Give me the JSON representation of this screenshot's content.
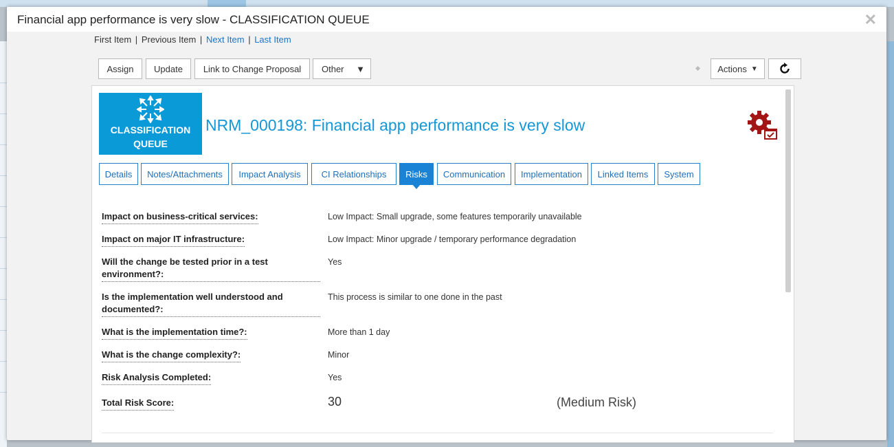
{
  "modal": {
    "title": "Financial app performance is very slow - CLASSIFICATION QUEUE",
    "close_icon": "close-icon"
  },
  "navigation": {
    "first_item": "First Item",
    "previous_item": "Previous Item",
    "next_item": "Next Item",
    "last_item": "Last Item",
    "separator": "|"
  },
  "toolbar": {
    "assign": "Assign",
    "update": "Update",
    "link_to_change_proposal": "Link to Change Proposal",
    "other": "Other",
    "actions": "Actions",
    "refresh_icon": "refresh-icon"
  },
  "record": {
    "queue_label_line1": "CLASSIFICATION",
    "queue_label_line2": "QUEUE",
    "title": "NRM_000198: Financial app performance is very slow",
    "status_icon": "gear-checklist-icon"
  },
  "tabs": [
    {
      "label": "Details"
    },
    {
      "label": "Notes/Attachments"
    },
    {
      "label": "Impact Analysis"
    },
    {
      "label": "CI Relationships"
    },
    {
      "label": "Risks"
    },
    {
      "label": "Communication"
    },
    {
      "label": "Implementation"
    },
    {
      "label": "Linked Items"
    },
    {
      "label": "System"
    }
  ],
  "active_tab": "Risks",
  "risks": [
    {
      "question": "Impact on business-critical services:",
      "answer": "Low Impact: Small upgrade, some features temporarily unavailable"
    },
    {
      "question": "Impact on major IT infrastructure:",
      "answer": "Low Impact: Minor upgrade / temporary performance degradation"
    },
    {
      "question": "Will the change be tested prior in a test environment?:",
      "answer": "Yes"
    },
    {
      "question": "Is the implementation well understood and documented?:",
      "answer": "This process is similar to one done in the past"
    },
    {
      "question": "What is the implementation time?:",
      "answer": "More than 1 day"
    },
    {
      "question": "What is the change complexity?:",
      "answer": "Minor"
    },
    {
      "question": "Risk Analysis Completed:",
      "answer": "Yes"
    }
  ],
  "total_risk": {
    "label": "Total Risk Score:",
    "score": "30",
    "level": "(Medium Risk)"
  },
  "colors": {
    "accent": "#1a83d6",
    "queue_tile": "#0a9ad8",
    "title_blue": "#1597d5",
    "gear_red": "#a31515"
  }
}
